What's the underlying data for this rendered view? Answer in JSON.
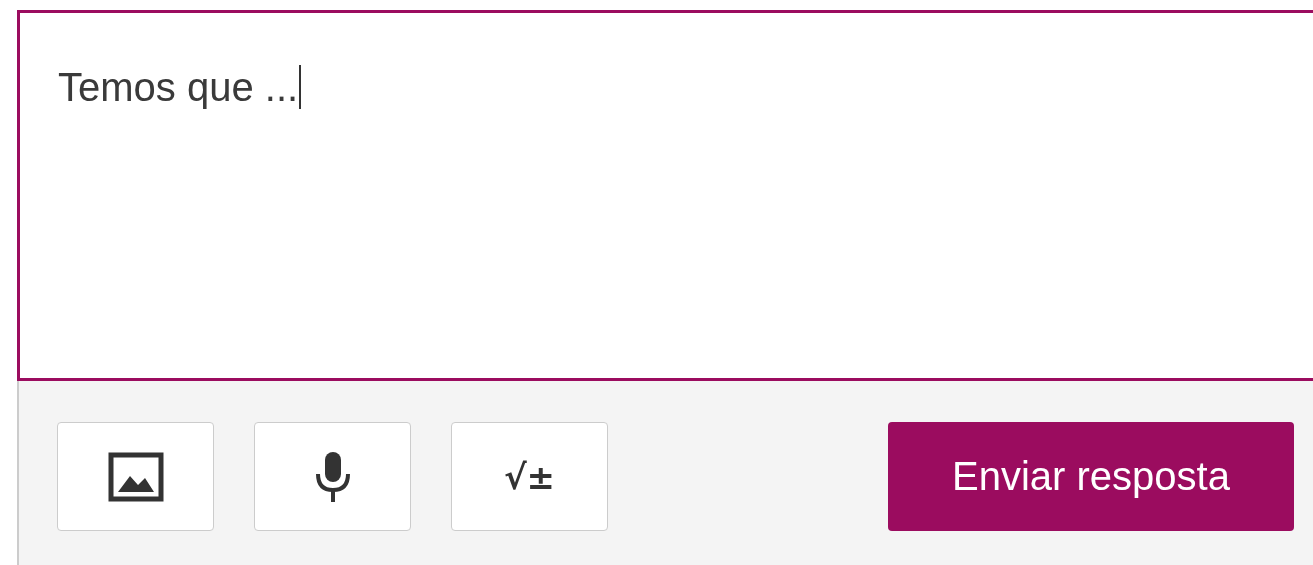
{
  "answer": {
    "value": "Temos que ...",
    "focused": true
  },
  "tools": [
    {
      "kind": "image"
    },
    {
      "kind": "microphone"
    },
    {
      "kind": "formula",
      "label": "√±"
    }
  ],
  "submit": {
    "label": "Enviar resposta"
  }
}
